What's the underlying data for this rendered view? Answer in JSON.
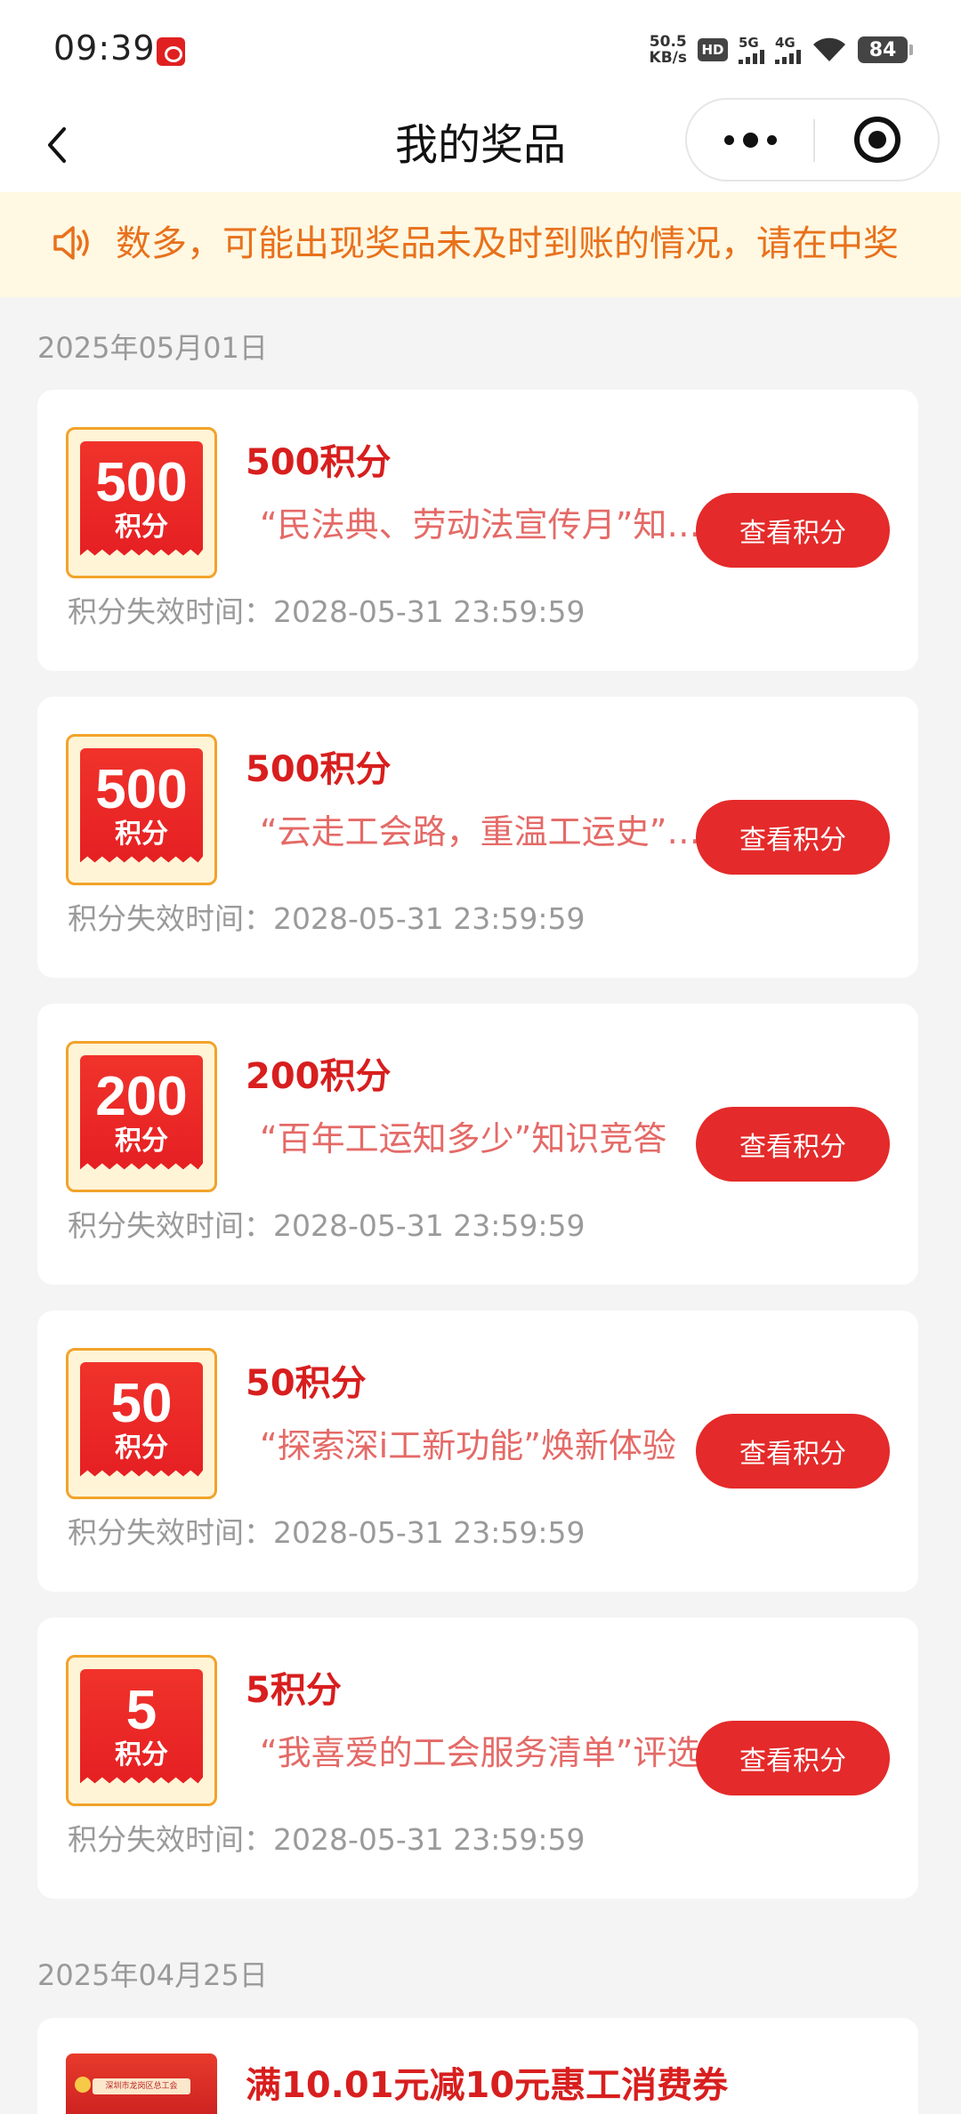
{
  "status_bar": {
    "time": "09:39",
    "net_speed_value": "50.5",
    "net_speed_unit": "KB/s",
    "hd_label": "HD",
    "sim1_label": "5G",
    "sim2_label": "4G",
    "battery": "84"
  },
  "nav": {
    "title": "我的奖品"
  },
  "notice": {
    "text": "数多，可能出现奖品未及时到账的情况，请在中奖"
  },
  "groups": [
    {
      "date": "2025年05月01日",
      "items": [
        {
          "amount": "500",
          "unit": "积分",
          "title": "500积分",
          "desc": "“民法典、劳动法宣传月”知识竞答",
          "button": "查看积分",
          "expire_label": "积分失效时间：",
          "expire_time": "2028-05-31 23:59:59"
        },
        {
          "amount": "500",
          "unit": "积分",
          "title": "500积分",
          "desc": "“云走工会路，重温工运史”活动",
          "button": "查看积分",
          "expire_label": "积分失效时间：",
          "expire_time": "2028-05-31 23:59:59"
        },
        {
          "amount": "200",
          "unit": "积分",
          "title": "200积分",
          "desc": "“百年工运知多少”知识竞答",
          "button": "查看积分",
          "expire_label": "积分失效时间：",
          "expire_time": "2028-05-31 23:59:59"
        },
        {
          "amount": "50",
          "unit": "积分",
          "title": "50积分",
          "desc": "“探索深i工新功能”焕新体验",
          "button": "查看积分",
          "expire_label": "积分失效时间：",
          "expire_time": "2028-05-31 23:59:59"
        },
        {
          "amount": "5",
          "unit": "积分",
          "title": "5积分",
          "desc": "“我喜爱的工会服务清单”评选",
          "button": "查看积分",
          "expire_label": "积分失效时间：",
          "expire_time": "2028-05-31 23:59:59"
        }
      ]
    },
    {
      "date": "2025年04月25日",
      "items": [
        {
          "title": "满10.01元减10元惠工消费券",
          "thumb_text": "深圳市龙岗区总工会"
        }
      ]
    }
  ],
  "colors": {
    "accent_red": "#e42a2a",
    "title_red": "#d81e1e",
    "notice_orange": "#e8711c",
    "notice_bg": "#fff8e2",
    "badge_gold": "#f2a32a"
  }
}
